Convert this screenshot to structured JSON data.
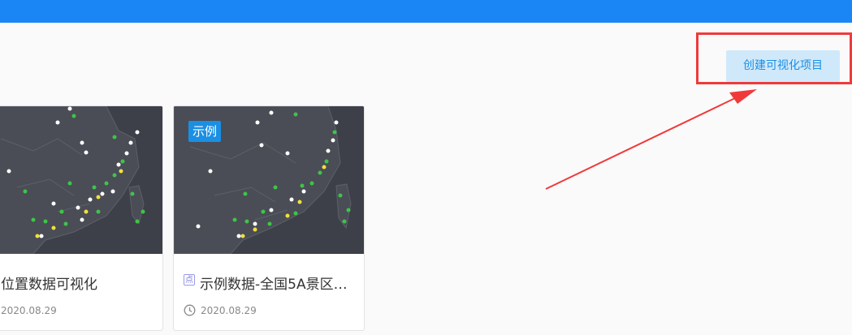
{
  "header": {
    "color": "#1a86f5"
  },
  "toolbar": {
    "create_label": "创建可视化项目"
  },
  "cards": [
    {
      "title": "位置数据可视化",
      "date": "2020.08.29",
      "tag": ""
    },
    {
      "title": "示例数据-全国5A景区…",
      "date": "2020.08.29",
      "tag": "示例",
      "type_icon": "point-icon"
    }
  ],
  "annotation": {
    "box_color": "#f03a3a",
    "arrow_color": "#f03a3a"
  }
}
